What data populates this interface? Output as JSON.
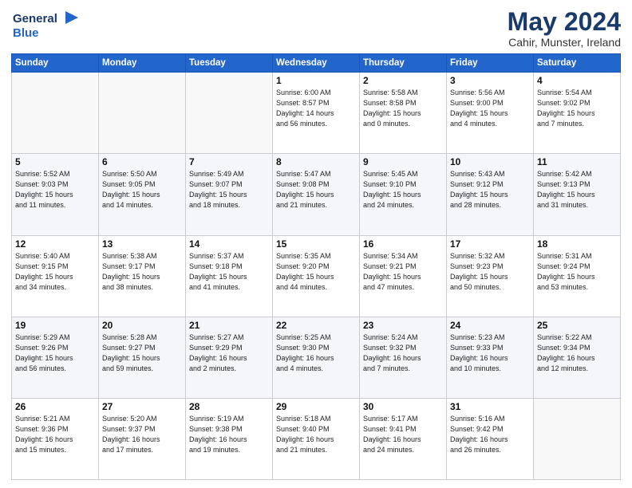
{
  "header": {
    "logo_line1": "General",
    "logo_line2": "Blue",
    "month": "May 2024",
    "location": "Cahir, Munster, Ireland"
  },
  "weekdays": [
    "Sunday",
    "Monday",
    "Tuesday",
    "Wednesday",
    "Thursday",
    "Friday",
    "Saturday"
  ],
  "weeks": [
    [
      {
        "day": "",
        "info": ""
      },
      {
        "day": "",
        "info": ""
      },
      {
        "day": "",
        "info": ""
      },
      {
        "day": "1",
        "info": "Sunrise: 6:00 AM\nSunset: 8:57 PM\nDaylight: 14 hours\nand 56 minutes."
      },
      {
        "day": "2",
        "info": "Sunrise: 5:58 AM\nSunset: 8:58 PM\nDaylight: 15 hours\nand 0 minutes."
      },
      {
        "day": "3",
        "info": "Sunrise: 5:56 AM\nSunset: 9:00 PM\nDaylight: 15 hours\nand 4 minutes."
      },
      {
        "day": "4",
        "info": "Sunrise: 5:54 AM\nSunset: 9:02 PM\nDaylight: 15 hours\nand 7 minutes."
      }
    ],
    [
      {
        "day": "5",
        "info": "Sunrise: 5:52 AM\nSunset: 9:03 PM\nDaylight: 15 hours\nand 11 minutes."
      },
      {
        "day": "6",
        "info": "Sunrise: 5:50 AM\nSunset: 9:05 PM\nDaylight: 15 hours\nand 14 minutes."
      },
      {
        "day": "7",
        "info": "Sunrise: 5:49 AM\nSunset: 9:07 PM\nDaylight: 15 hours\nand 18 minutes."
      },
      {
        "day": "8",
        "info": "Sunrise: 5:47 AM\nSunset: 9:08 PM\nDaylight: 15 hours\nand 21 minutes."
      },
      {
        "day": "9",
        "info": "Sunrise: 5:45 AM\nSunset: 9:10 PM\nDaylight: 15 hours\nand 24 minutes."
      },
      {
        "day": "10",
        "info": "Sunrise: 5:43 AM\nSunset: 9:12 PM\nDaylight: 15 hours\nand 28 minutes."
      },
      {
        "day": "11",
        "info": "Sunrise: 5:42 AM\nSunset: 9:13 PM\nDaylight: 15 hours\nand 31 minutes."
      }
    ],
    [
      {
        "day": "12",
        "info": "Sunrise: 5:40 AM\nSunset: 9:15 PM\nDaylight: 15 hours\nand 34 minutes."
      },
      {
        "day": "13",
        "info": "Sunrise: 5:38 AM\nSunset: 9:17 PM\nDaylight: 15 hours\nand 38 minutes."
      },
      {
        "day": "14",
        "info": "Sunrise: 5:37 AM\nSunset: 9:18 PM\nDaylight: 15 hours\nand 41 minutes."
      },
      {
        "day": "15",
        "info": "Sunrise: 5:35 AM\nSunset: 9:20 PM\nDaylight: 15 hours\nand 44 minutes."
      },
      {
        "day": "16",
        "info": "Sunrise: 5:34 AM\nSunset: 9:21 PM\nDaylight: 15 hours\nand 47 minutes."
      },
      {
        "day": "17",
        "info": "Sunrise: 5:32 AM\nSunset: 9:23 PM\nDaylight: 15 hours\nand 50 minutes."
      },
      {
        "day": "18",
        "info": "Sunrise: 5:31 AM\nSunset: 9:24 PM\nDaylight: 15 hours\nand 53 minutes."
      }
    ],
    [
      {
        "day": "19",
        "info": "Sunrise: 5:29 AM\nSunset: 9:26 PM\nDaylight: 15 hours\nand 56 minutes."
      },
      {
        "day": "20",
        "info": "Sunrise: 5:28 AM\nSunset: 9:27 PM\nDaylight: 15 hours\nand 59 minutes."
      },
      {
        "day": "21",
        "info": "Sunrise: 5:27 AM\nSunset: 9:29 PM\nDaylight: 16 hours\nand 2 minutes."
      },
      {
        "day": "22",
        "info": "Sunrise: 5:25 AM\nSunset: 9:30 PM\nDaylight: 16 hours\nand 4 minutes."
      },
      {
        "day": "23",
        "info": "Sunrise: 5:24 AM\nSunset: 9:32 PM\nDaylight: 16 hours\nand 7 minutes."
      },
      {
        "day": "24",
        "info": "Sunrise: 5:23 AM\nSunset: 9:33 PM\nDaylight: 16 hours\nand 10 minutes."
      },
      {
        "day": "25",
        "info": "Sunrise: 5:22 AM\nSunset: 9:34 PM\nDaylight: 16 hours\nand 12 minutes."
      }
    ],
    [
      {
        "day": "26",
        "info": "Sunrise: 5:21 AM\nSunset: 9:36 PM\nDaylight: 16 hours\nand 15 minutes."
      },
      {
        "day": "27",
        "info": "Sunrise: 5:20 AM\nSunset: 9:37 PM\nDaylight: 16 hours\nand 17 minutes."
      },
      {
        "day": "28",
        "info": "Sunrise: 5:19 AM\nSunset: 9:38 PM\nDaylight: 16 hours\nand 19 minutes."
      },
      {
        "day": "29",
        "info": "Sunrise: 5:18 AM\nSunset: 9:40 PM\nDaylight: 16 hours\nand 21 minutes."
      },
      {
        "day": "30",
        "info": "Sunrise: 5:17 AM\nSunset: 9:41 PM\nDaylight: 16 hours\nand 24 minutes."
      },
      {
        "day": "31",
        "info": "Sunrise: 5:16 AM\nSunset: 9:42 PM\nDaylight: 16 hours\nand 26 minutes."
      },
      {
        "day": "",
        "info": ""
      }
    ]
  ]
}
